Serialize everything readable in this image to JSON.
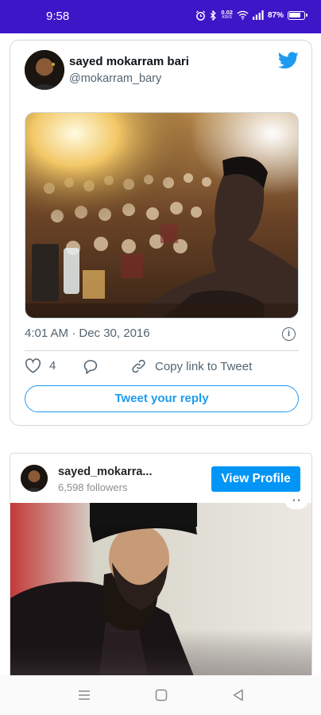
{
  "status_bar": {
    "time": "9:58",
    "data_speed_value": "0.02",
    "data_speed_unit": "KB/S",
    "battery": "87%",
    "icons": [
      "alarm-icon",
      "bluetooth-icon",
      "wifi-icon",
      "signal-icon",
      "battery-icon"
    ]
  },
  "tweet": {
    "author_name": "sayed mokarram bari",
    "author_handle": "@mokarram_bary",
    "timestamp": "4:01 AM · Dec 30, 2016",
    "like_count": "4",
    "copy_link_label": "Copy link to Tweet",
    "reply_button_label": "Tweet your reply",
    "brand_color": "#1d9bf0"
  },
  "instagram": {
    "username": "sayed_mokarra...",
    "followers": "6,598 followers",
    "view_profile_label": "View Profile",
    "button_color": "#0095f6"
  },
  "nav_bar": {
    "buttons": [
      "menu-icon",
      "home-icon",
      "back-icon"
    ]
  }
}
